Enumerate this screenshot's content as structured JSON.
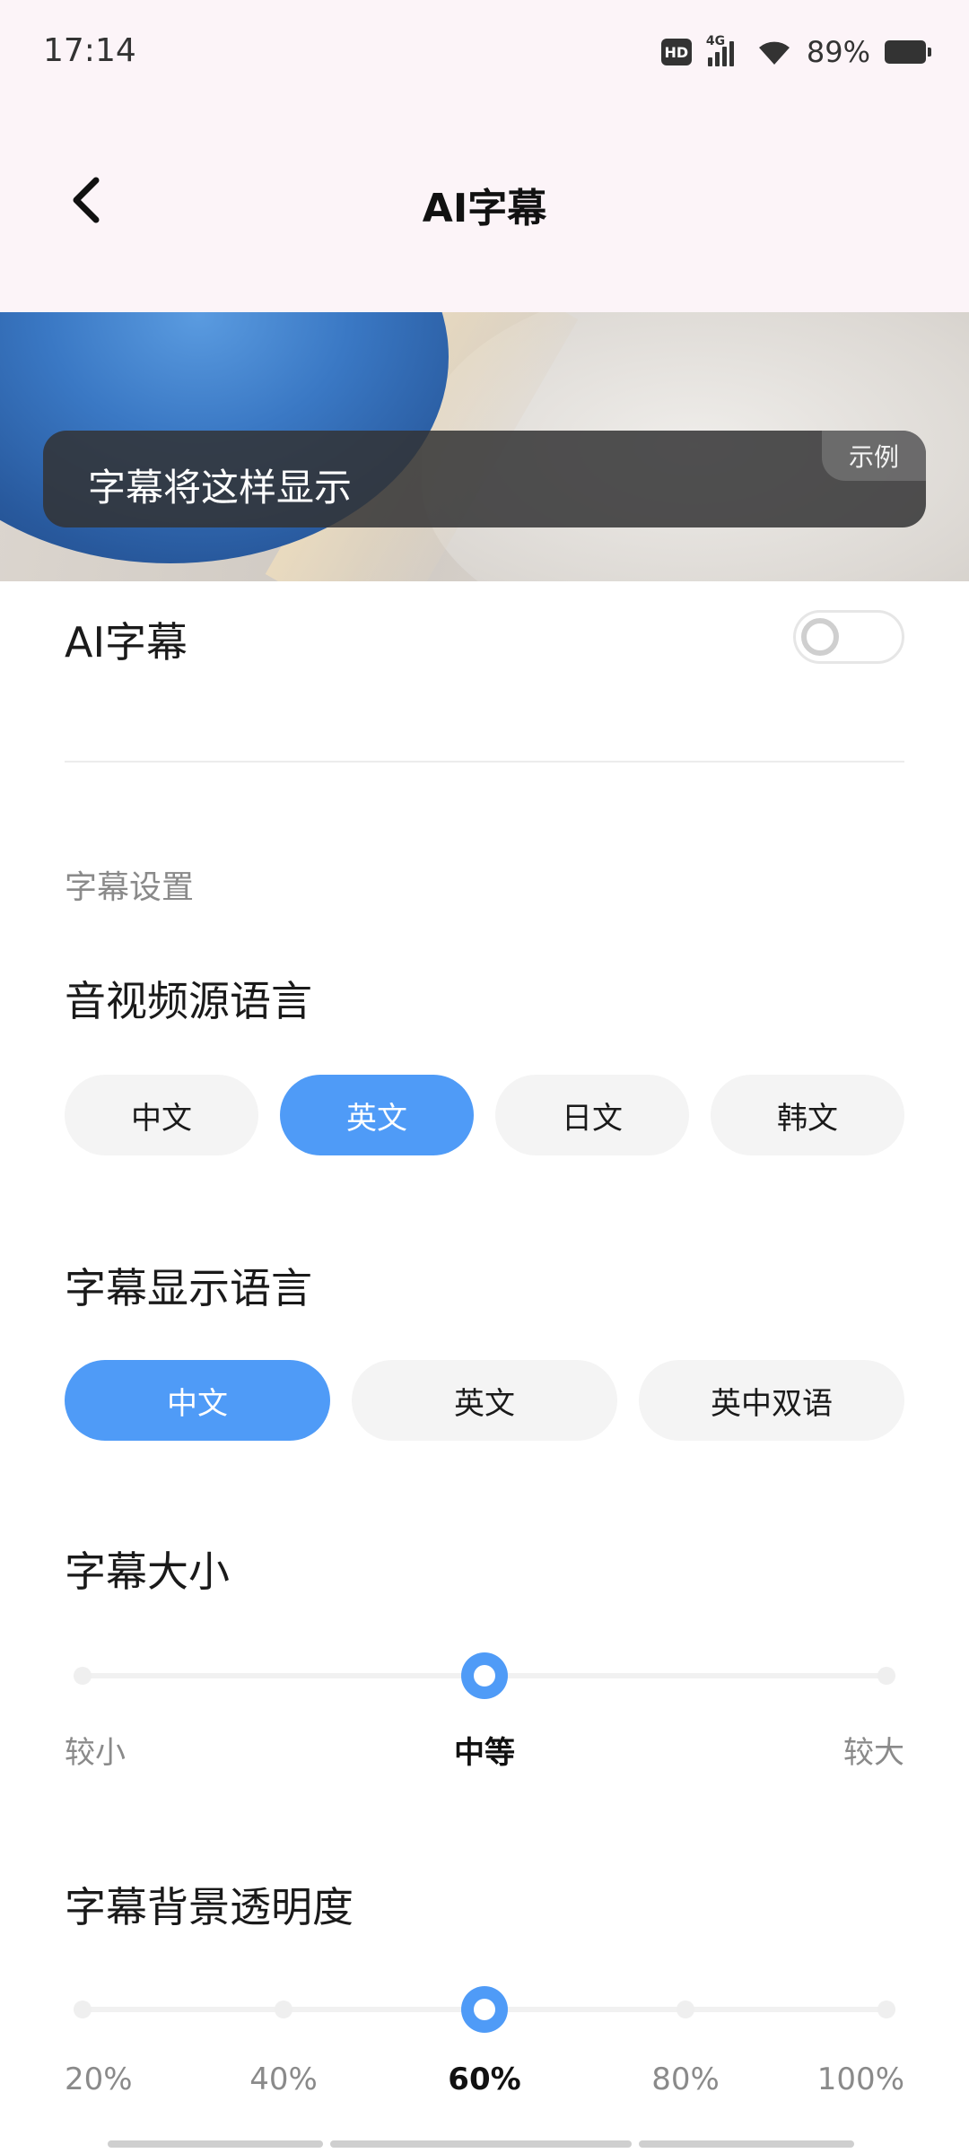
{
  "status_bar": {
    "time": "17:14",
    "hd_label": "HD",
    "network_label": "4G",
    "battery_percent": "89%",
    "icons": [
      "hd-icon",
      "signal-icon",
      "wifi-icon",
      "battery-icon"
    ]
  },
  "header": {
    "title": "AI字幕",
    "back_icon": "chevron-left-icon"
  },
  "preview": {
    "caption": "字幕将这样显示",
    "tag": "示例"
  },
  "ai_subtitle": {
    "label": "AI字幕",
    "enabled": false
  },
  "settings": {
    "section_title": "字幕设置",
    "source_language": {
      "title": "音视频源语言",
      "options": [
        "中文",
        "英文",
        "日文",
        "韩文"
      ],
      "selected": "英文"
    },
    "display_language": {
      "title": "字幕显示语言",
      "options": [
        "中文",
        "英文",
        "英中双语"
      ],
      "selected": "中文"
    },
    "font_size": {
      "title": "字幕大小",
      "labels": [
        "较小",
        "中等",
        "较大"
      ],
      "selected": "中等",
      "selected_index": 1,
      "steps": 3
    },
    "bg_opacity": {
      "title": "字幕背景透明度",
      "labels": [
        "20%",
        "40%",
        "60%",
        "80%",
        "100%"
      ],
      "selected": "60%",
      "selected_index": 2,
      "steps": 5
    }
  },
  "colors": {
    "accent": "#4f9bf7",
    "chip_bg": "#f4f4f4",
    "header_bg": "#fcf4f8"
  }
}
